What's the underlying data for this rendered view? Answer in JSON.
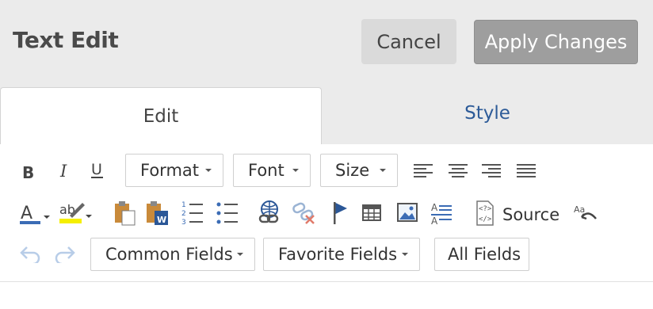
{
  "header": {
    "title": "Text Edit",
    "cancel_label": "Cancel",
    "apply_label": "Apply Changes"
  },
  "tabs": [
    {
      "label": "Edit",
      "active": true
    },
    {
      "label": "Style",
      "active": false
    }
  ],
  "toolbar": {
    "format_label": "Format",
    "font_label": "Font",
    "size_label": "Size",
    "source_label": "Source",
    "common_fields_label": "Common Fields",
    "favorite_fields_label": "Favorite Fields",
    "all_fields_label": "All Fields"
  },
  "colors": {
    "accent": "#2d5b98",
    "text_color_bar": "#3b6cb5",
    "highlight": "#f5ef00",
    "header_bg": "#ebebeb"
  },
  "icons": [
    "bold-icon",
    "italic-icon",
    "underline-icon",
    "align-left-icon",
    "align-center-icon",
    "align-right-icon",
    "justify-icon",
    "text-color-icon",
    "highlight-icon",
    "paste-icon",
    "paste-word-icon",
    "numbered-list-icon",
    "bullet-list-icon",
    "link-icon",
    "unlink-icon",
    "anchor-icon",
    "table-icon",
    "image-icon",
    "line-spacing-icon",
    "source-icon",
    "remove-format-icon",
    "undo-icon",
    "redo-icon"
  ]
}
